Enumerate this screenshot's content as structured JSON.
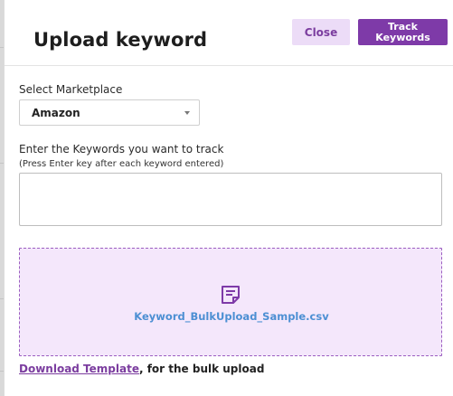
{
  "header": {
    "title": "Upload keyword",
    "close_label": "Close",
    "track_label": "Track Keywords"
  },
  "marketplace": {
    "label": "Select Marketplace",
    "value": "Amazon"
  },
  "keywords": {
    "label": "Enter the Keywords you want to track",
    "hint": "(Press Enter key after each keyword entered)",
    "value": ""
  },
  "upload": {
    "file_name": "Keyword_BulkUpload_Sample.csv",
    "icon": "file-document-icon"
  },
  "download": {
    "link_text": "Download Template",
    "suffix_text": ", for the bulk upload"
  },
  "colors": {
    "accent": "#7e3aa8",
    "accent_light": "#ecdcf7",
    "dropzone_bg": "#f4e7fb",
    "file_link": "#4c8fd3"
  }
}
